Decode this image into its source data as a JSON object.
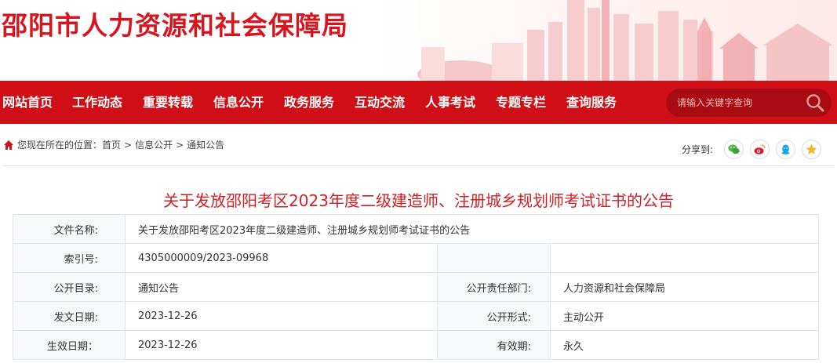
{
  "site": {
    "title": "邵阳市人力资源和社会保障局",
    "accent": "#cf0e16",
    "title_color": "#d8151f"
  },
  "nav": {
    "items": [
      {
        "label": "网站首页"
      },
      {
        "label": "工作动态"
      },
      {
        "label": "重要转载"
      },
      {
        "label": "信息公开"
      },
      {
        "label": "政务服务"
      },
      {
        "label": "互动交流"
      },
      {
        "label": "人事考试"
      },
      {
        "label": "专题专栏"
      },
      {
        "label": "查询服务"
      }
    ],
    "search": {
      "placeholder": "请输入关键字查询",
      "icon": "search-icon"
    }
  },
  "breadcrumb": {
    "prefix": "您现在所在的位置：",
    "items": [
      "首页",
      "信息公开",
      "通知公告"
    ],
    "separator": ">",
    "icon": "home-icon"
  },
  "share": {
    "label": "分享到:",
    "icons": [
      "wechat-icon",
      "weibo-icon",
      "qq-icon",
      "qzone-icon"
    ]
  },
  "article": {
    "title": "关于发放邵阳考区2023年度二级建造师、注册城乡规划师考试证书的公告",
    "title_color": "#d21f26"
  },
  "info": {
    "file_name_label": "文件名称:",
    "file_name_value": "关于发放邵阳考区2023年度二级建造师、注册城乡规划师考试证书的公告",
    "index_label": "索引号:",
    "index_value": "4305000009/2023-09968",
    "catalog_label": "公开目录:",
    "catalog_value": "通知公告",
    "dept_label": "公开责任部门:",
    "dept_value": "人力资源和社会保障局",
    "issue_date_label": "发文日期:",
    "issue_date_value": "2023-12-26",
    "form_label": "公开形式:",
    "form_value": "主动公开",
    "effective_label": "生效日期：",
    "effective_value": "2023-12-26",
    "validity_label": "有效期:",
    "validity_value": "永久"
  }
}
